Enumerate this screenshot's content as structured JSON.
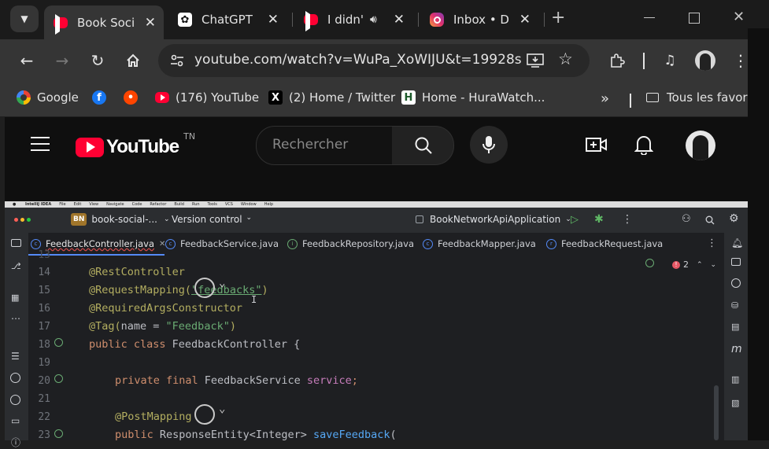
{
  "browser": {
    "tabs": [
      {
        "title": "Book Socia",
        "favicon": "youtube-icon",
        "active": true
      },
      {
        "title": "ChatGPT",
        "favicon": "chatgpt-icon",
        "active": false
      },
      {
        "title": "I didn't",
        "favicon": "youtube-icon",
        "active": false,
        "audio": true
      },
      {
        "title": "Inbox • Dir",
        "favicon": "instagram-icon",
        "active": false
      }
    ],
    "url": "youtube.com/watch?v=WuPa_XoWIJU&t=19928s",
    "bookmarks": [
      {
        "label": "Google",
        "icon": "google-icon"
      },
      {
        "label": "",
        "icon": "facebook-icon"
      },
      {
        "label": "",
        "icon": "reddit-icon"
      },
      {
        "label": "(176) YouTube",
        "icon": "youtube-icon"
      },
      {
        "label": "(2) Home / Twitter",
        "icon": "x-icon"
      },
      {
        "label": "Home - HuraWatch...",
        "icon": "hurawatch-icon"
      }
    ],
    "all_bookmarks": "Tous les favoris"
  },
  "youtube": {
    "logo_text": "YouTube",
    "country_code": "TN",
    "search_placeholder": "Rechercher"
  },
  "ide": {
    "menu": [
      "IntelliJ IDEA",
      "File",
      "Edit",
      "View",
      "Navigate",
      "Code",
      "Refactor",
      "Build",
      "Run",
      "Tools",
      "VCS",
      "Window",
      "Help"
    ],
    "project_badge": "BN",
    "project_name": "book-social-...",
    "version_control": "Version control",
    "run_config": "BookNetworkApiApplication",
    "tabs": [
      {
        "label": "FeedbackController.java",
        "active": true
      },
      {
        "label": "FeedbackService.java",
        "active": false
      },
      {
        "label": "FeedbackRepository.java",
        "active": false
      },
      {
        "label": "FeedbackMapper.java",
        "active": false
      },
      {
        "label": "FeedbackRequest.java",
        "active": false
      }
    ],
    "error_count": "2",
    "line_numbers": [
      "14",
      "15",
      "16",
      "17",
      "18",
      "19",
      "20",
      "21",
      "22",
      "23"
    ],
    "code": {
      "l14": "@RestController",
      "l15_a": "@RequestMapping(",
      "l15_b": "\"feedbacks\"",
      "l15_c": ")",
      "l16": "@RequiredArgsConstructor",
      "l17_a": "@Tag(",
      "l17_b": "name = ",
      "l17_c": "\"Feedback\"",
      "l17_d": ")",
      "l18_a": "public class ",
      "l18_b": "FeedbackController {",
      "l20_a": "private final ",
      "l20_b": "FeedbackService ",
      "l20_c": "service",
      "l20_d": ";",
      "l22": "@PostMapping",
      "l23_a": "public ",
      "l23_b": "ResponseEntity<Integer> ",
      "l23_c": "saveFeedback",
      "l23_d": "("
    }
  },
  "colors": {
    "youtube_red": "#ff0033",
    "annotation": "#b3ae60",
    "keyword": "#cf8e6d",
    "string": "#6aab73",
    "field": "#c77dbb",
    "function": "#56a8f5"
  }
}
